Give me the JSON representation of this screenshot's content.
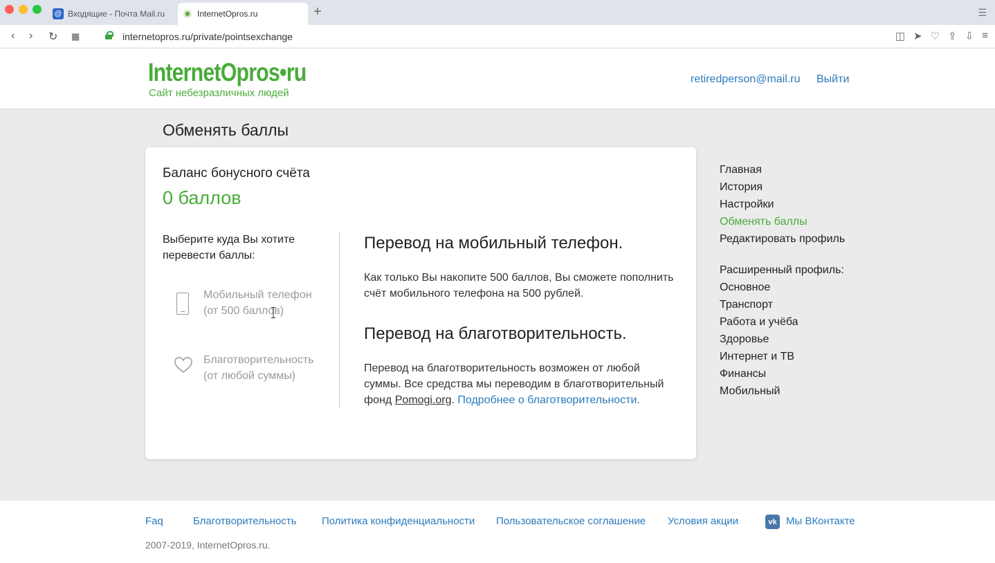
{
  "browser": {
    "tabs": [
      {
        "label": "Входящие - Почта Mail.ru",
        "icon": "mail-ru-favicon"
      },
      {
        "label": "InternetOpros.ru",
        "icon": "internetopros-favicon"
      }
    ],
    "url": "internetopros.ru/private/pointsexchange"
  },
  "header": {
    "logo_title": "InternetOpros•ru",
    "logo_subtitle": "Сайт небезразличных людей",
    "user_email": "retiredperson@mail.ru",
    "logout_label": "Выйти"
  },
  "page": {
    "title": "Обменять баллы"
  },
  "card": {
    "balance_label": "Баланс бонусного счёта",
    "balance_value": "0 баллов",
    "choose_text": "Выберите куда Вы хотите перевести баллы:",
    "options": [
      {
        "label": "Мобильный телефон (от 500 баллов)",
        "icon": "phone-icon"
      },
      {
        "label": "Благотворительность (от любой суммы)",
        "icon": "heart-icon"
      }
    ],
    "mobile_heading": "Перевод на мобильный телефон.",
    "mobile_text": "Как только Вы накопите 500 баллов, Вы сможете пополнить счёт мобильного телефона на 500 рублей.",
    "charity_heading": "Перевод на благотворительность.",
    "charity_text": "Перевод на благотворительность возможен от любой суммы. Все средства мы переводим в благотворительный фонд ",
    "charity_fund_link": "Pomogi.org",
    "charity_sep": ". ",
    "charity_more_link": "Подробнее о благотворительности."
  },
  "sidebar": {
    "items": [
      "Главная",
      "История",
      "Настройки",
      "Обменять баллы",
      "Редактировать профиль"
    ],
    "active_item": "Обменять баллы",
    "extended_label": "Расширенный профиль:",
    "extended_items": [
      "Основное",
      "Транспорт",
      "Работа и учёба",
      "Здоровье",
      "Интернет и ТВ",
      "Финансы",
      "Мобильный"
    ]
  },
  "footer": {
    "links": [
      "Faq",
      "Благотворительность",
      "Политика конфиденциальности",
      "Пользовательское соглашение",
      "Условия акции"
    ],
    "vk_label": "Мы ВКонтакте",
    "copyright": "2007-2019, InternetOpros.ru."
  },
  "colors": {
    "brand_green": "#4aab3a",
    "link_blue": "#2c7bbd"
  }
}
